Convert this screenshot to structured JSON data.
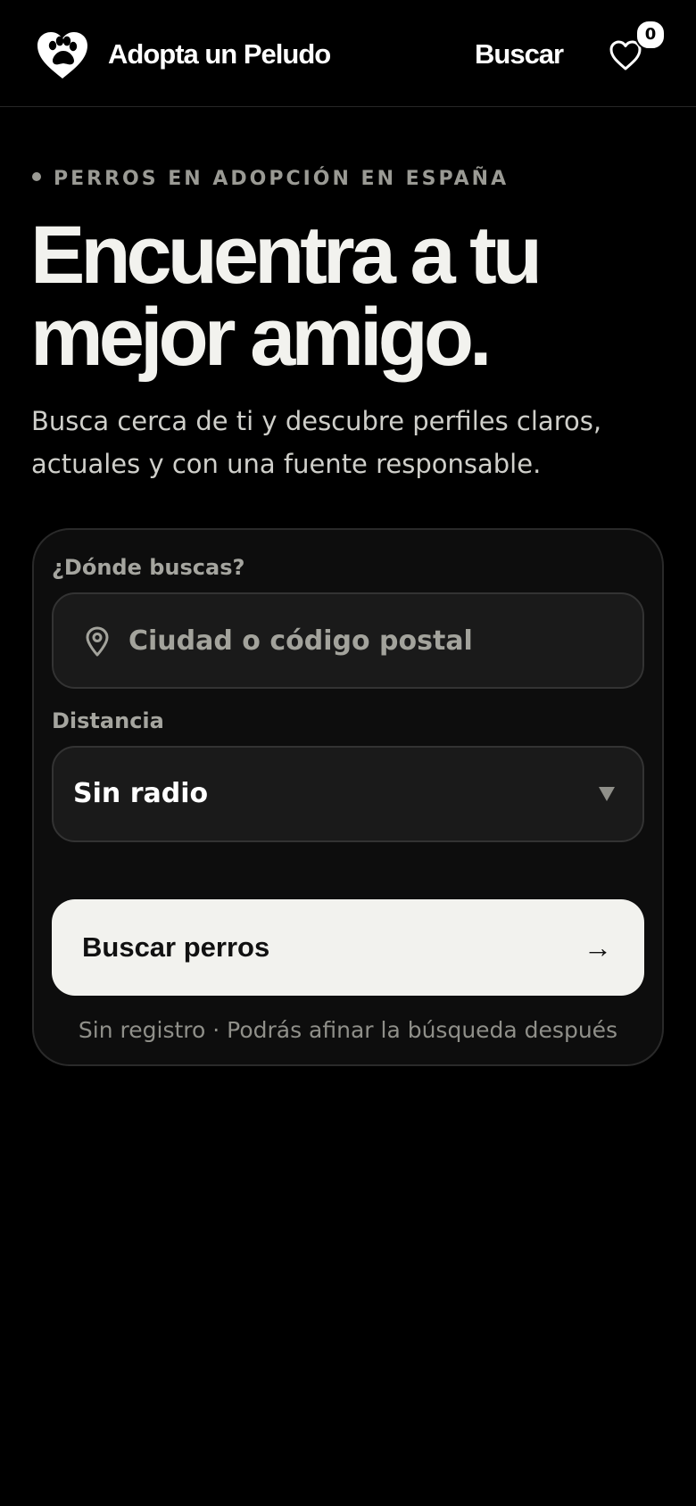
{
  "header": {
    "brand": "Adopta un Peludo",
    "nav_search_label": "Buscar",
    "favorites_count": "0",
    "logo_icon": "heart-paw-icon",
    "favorites_icon": "heart-outline-icon"
  },
  "hero": {
    "eyebrow": "PERROS EN ADOPCIÓN EN ESPAÑA",
    "title_line1": "Encuentra a tu",
    "title_line2": "mejor amigo.",
    "subtitle": "Busca cerca de ti y descubre perfiles claros, actuales y con una fuente responsable."
  },
  "search_form": {
    "location_label": "¿Dónde buscas?",
    "location_placeholder": "Ciudad o código postal",
    "location_value": "",
    "location_icon": "map-pin-icon",
    "distance_label": "Distancia",
    "distance_selected": "Sin radio",
    "distance_icon": "caret-down-icon",
    "submit_label": "Buscar perros",
    "submit_arrow": "→",
    "footnote": "Sin registro · Podrás afinar la búsqueda después"
  },
  "colors": {
    "background": "#000000",
    "card_background": "#0d0d0d",
    "field_background": "#1a1a1a",
    "primary_text": "#f2f2ee",
    "muted_text": "#9a9a94",
    "button_background": "#f2f2ee",
    "button_text": "#111111"
  }
}
